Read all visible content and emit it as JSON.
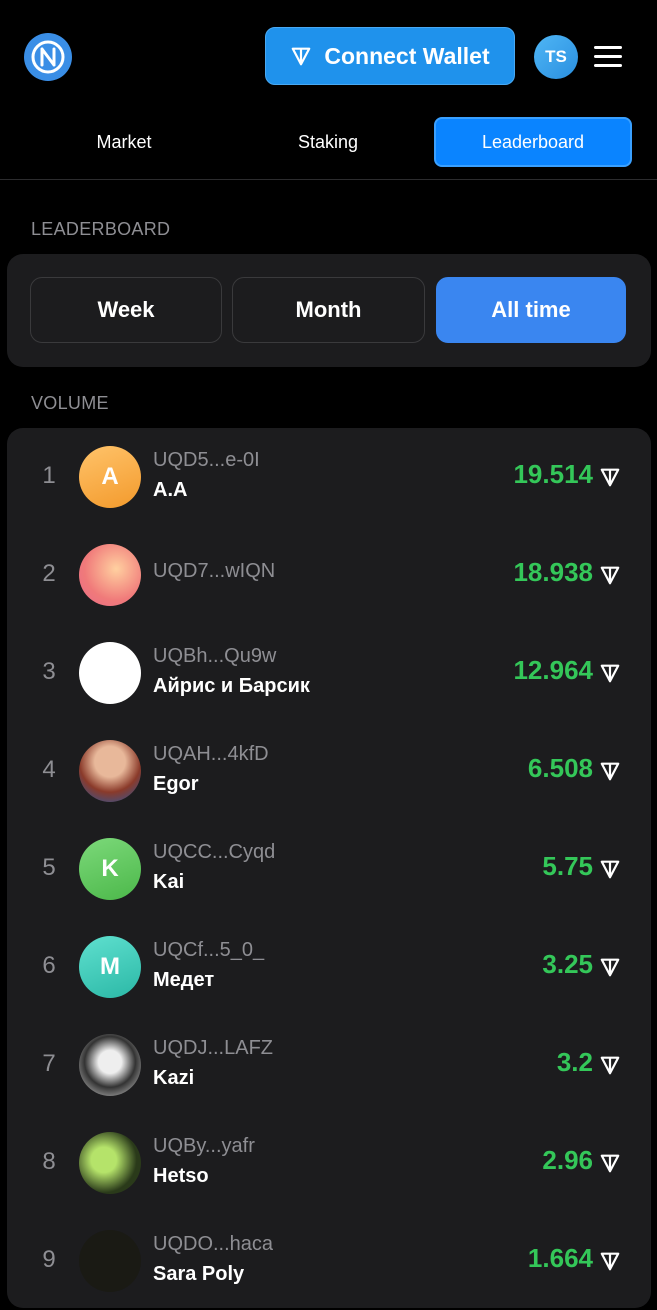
{
  "header": {
    "connect_label": "Connect Wallet",
    "avatar_initials": "TS"
  },
  "nav": {
    "tabs": [
      {
        "label": "Market"
      },
      {
        "label": "Staking"
      },
      {
        "label": "Leaderboard",
        "active": true
      }
    ]
  },
  "leaderboard": {
    "section_label": "LEADERBOARD",
    "periods": [
      {
        "label": "Week"
      },
      {
        "label": "Month"
      },
      {
        "label": "All time",
        "active": true
      }
    ]
  },
  "volume": {
    "section_label": "VOLUME",
    "rows": [
      {
        "rank": "1",
        "address": "UQD5...e-0I",
        "name": "A.A",
        "amount": "19.514",
        "avatar_letter": "A",
        "avatar_color": "#f5a742"
      },
      {
        "rank": "2",
        "address": "UQD7...wIQN",
        "name": "",
        "amount": "18.938",
        "avatar_letter": "",
        "avatar_color": "#f08a7e"
      },
      {
        "rank": "3",
        "address": "UQBh...Qu9w",
        "name": "Айрис и Барсик",
        "amount": "12.964",
        "avatar_letter": "",
        "avatar_color": "#ffffff"
      },
      {
        "rank": "4",
        "address": "UQAH...4kfD",
        "name": "Egor",
        "amount": "6.508",
        "avatar_letter": "",
        "avatar_color": "#7a5a4a"
      },
      {
        "rank": "5",
        "address": "UQCC...Cyqd",
        "name": "Kai",
        "amount": "5.75",
        "avatar_letter": "K",
        "avatar_color": "#5ec45a"
      },
      {
        "rank": "6",
        "address": "UQCf...5_0_",
        "name": "Медет",
        "amount": "3.25",
        "avatar_letter": "M",
        "avatar_color": "#35c7b5"
      },
      {
        "rank": "7",
        "address": "UQDJ...LAFZ",
        "name": "Kazi",
        "amount": "3.2",
        "avatar_letter": "",
        "avatar_color": "#d9d9d9"
      },
      {
        "rank": "8",
        "address": "UQBy...yafr",
        "name": "Hetso",
        "amount": "2.96",
        "avatar_letter": "",
        "avatar_color": "#3a4a2a"
      },
      {
        "rank": "9",
        "address": "UQDO...haca",
        "name": "Sara Poly",
        "amount": "1.664",
        "avatar_letter": "",
        "avatar_color": "#1a1a14"
      }
    ]
  },
  "colors": {
    "accent": "#0a84ff",
    "amount": "#34c759",
    "card": "#1c1c1e"
  }
}
